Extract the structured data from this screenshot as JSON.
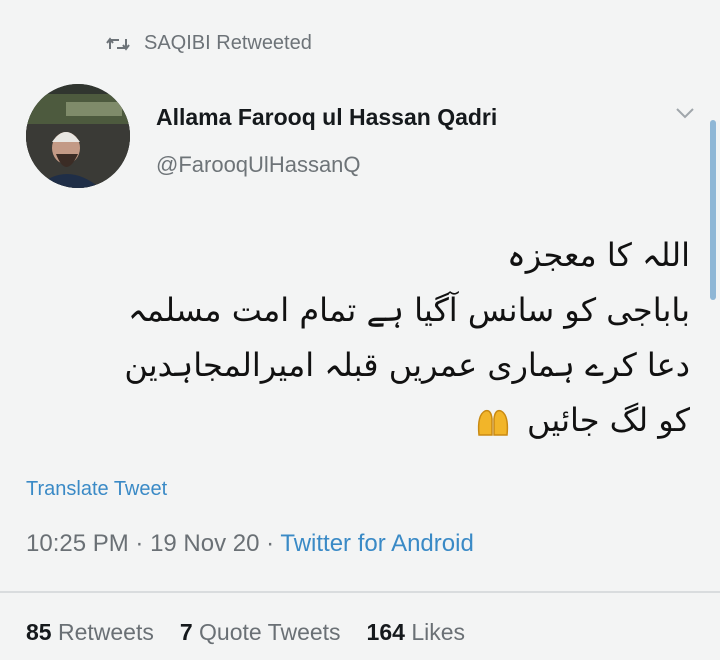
{
  "retweet": {
    "icon": "retweet-icon",
    "text": "SAQIBI Retweeted"
  },
  "author": {
    "name": "Allama Farooq ul Hassan Qadri",
    "handle": "@FarooqUlHassanQ",
    "avatar_icon": "avatar-photo"
  },
  "menu_icon": "chevron-down-icon",
  "tweet": {
    "lines": [
      "اللہ کا معجزہ",
      "باباجی کو سانس آگیا ہے تمام امت مسلمہ",
      "دعا کرے ہماری عمریں قبلہ امیرالمجاہدین",
      "کو لگ جائیں"
    ],
    "emoji": "🤲"
  },
  "translate_label": "Translate Tweet",
  "meta": {
    "time": "10:25 PM",
    "sep1": " · ",
    "date": "19 Nov 20",
    "sep2": " · ",
    "source": "Twitter for Android"
  },
  "stats": {
    "retweets_count": "85",
    "retweets_label": "Retweets",
    "quotes_count": "7",
    "quotes_label": "Quote Tweets",
    "likes_count": "164",
    "likes_label": "Likes"
  },
  "colors": {
    "link": "#3a8ac6",
    "muted": "#6a7075",
    "background": "#f3f4f4"
  }
}
